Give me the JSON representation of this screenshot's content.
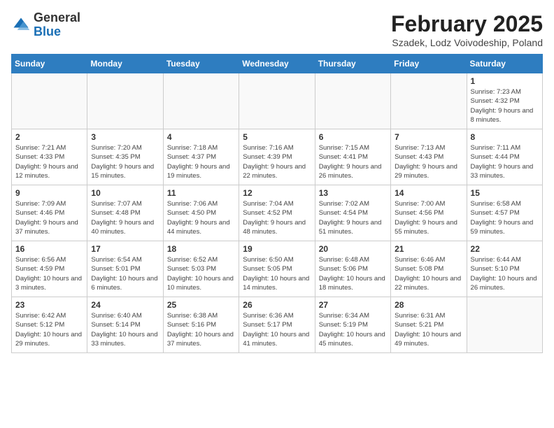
{
  "logo": {
    "general": "General",
    "blue": "Blue"
  },
  "header": {
    "title": "February 2025",
    "subtitle": "Szadek, Lodz Voivodeship, Poland"
  },
  "weekdays": [
    "Sunday",
    "Monday",
    "Tuesday",
    "Wednesday",
    "Thursday",
    "Friday",
    "Saturday"
  ],
  "weeks": [
    [
      {
        "day": "",
        "info": ""
      },
      {
        "day": "",
        "info": ""
      },
      {
        "day": "",
        "info": ""
      },
      {
        "day": "",
        "info": ""
      },
      {
        "day": "",
        "info": ""
      },
      {
        "day": "",
        "info": ""
      },
      {
        "day": "1",
        "info": "Sunrise: 7:23 AM\nSunset: 4:32 PM\nDaylight: 9 hours and 8 minutes."
      }
    ],
    [
      {
        "day": "2",
        "info": "Sunrise: 7:21 AM\nSunset: 4:33 PM\nDaylight: 9 hours and 12 minutes."
      },
      {
        "day": "3",
        "info": "Sunrise: 7:20 AM\nSunset: 4:35 PM\nDaylight: 9 hours and 15 minutes."
      },
      {
        "day": "4",
        "info": "Sunrise: 7:18 AM\nSunset: 4:37 PM\nDaylight: 9 hours and 19 minutes."
      },
      {
        "day": "5",
        "info": "Sunrise: 7:16 AM\nSunset: 4:39 PM\nDaylight: 9 hours and 22 minutes."
      },
      {
        "day": "6",
        "info": "Sunrise: 7:15 AM\nSunset: 4:41 PM\nDaylight: 9 hours and 26 minutes."
      },
      {
        "day": "7",
        "info": "Sunrise: 7:13 AM\nSunset: 4:43 PM\nDaylight: 9 hours and 29 minutes."
      },
      {
        "day": "8",
        "info": "Sunrise: 7:11 AM\nSunset: 4:44 PM\nDaylight: 9 hours and 33 minutes."
      }
    ],
    [
      {
        "day": "9",
        "info": "Sunrise: 7:09 AM\nSunset: 4:46 PM\nDaylight: 9 hours and 37 minutes."
      },
      {
        "day": "10",
        "info": "Sunrise: 7:07 AM\nSunset: 4:48 PM\nDaylight: 9 hours and 40 minutes."
      },
      {
        "day": "11",
        "info": "Sunrise: 7:06 AM\nSunset: 4:50 PM\nDaylight: 9 hours and 44 minutes."
      },
      {
        "day": "12",
        "info": "Sunrise: 7:04 AM\nSunset: 4:52 PM\nDaylight: 9 hours and 48 minutes."
      },
      {
        "day": "13",
        "info": "Sunrise: 7:02 AM\nSunset: 4:54 PM\nDaylight: 9 hours and 51 minutes."
      },
      {
        "day": "14",
        "info": "Sunrise: 7:00 AM\nSunset: 4:56 PM\nDaylight: 9 hours and 55 minutes."
      },
      {
        "day": "15",
        "info": "Sunrise: 6:58 AM\nSunset: 4:57 PM\nDaylight: 9 hours and 59 minutes."
      }
    ],
    [
      {
        "day": "16",
        "info": "Sunrise: 6:56 AM\nSunset: 4:59 PM\nDaylight: 10 hours and 3 minutes."
      },
      {
        "day": "17",
        "info": "Sunrise: 6:54 AM\nSunset: 5:01 PM\nDaylight: 10 hours and 6 minutes."
      },
      {
        "day": "18",
        "info": "Sunrise: 6:52 AM\nSunset: 5:03 PM\nDaylight: 10 hours and 10 minutes."
      },
      {
        "day": "19",
        "info": "Sunrise: 6:50 AM\nSunset: 5:05 PM\nDaylight: 10 hours and 14 minutes."
      },
      {
        "day": "20",
        "info": "Sunrise: 6:48 AM\nSunset: 5:06 PM\nDaylight: 10 hours and 18 minutes."
      },
      {
        "day": "21",
        "info": "Sunrise: 6:46 AM\nSunset: 5:08 PM\nDaylight: 10 hours and 22 minutes."
      },
      {
        "day": "22",
        "info": "Sunrise: 6:44 AM\nSunset: 5:10 PM\nDaylight: 10 hours and 26 minutes."
      }
    ],
    [
      {
        "day": "23",
        "info": "Sunrise: 6:42 AM\nSunset: 5:12 PM\nDaylight: 10 hours and 29 minutes."
      },
      {
        "day": "24",
        "info": "Sunrise: 6:40 AM\nSunset: 5:14 PM\nDaylight: 10 hours and 33 minutes."
      },
      {
        "day": "25",
        "info": "Sunrise: 6:38 AM\nSunset: 5:16 PM\nDaylight: 10 hours and 37 minutes."
      },
      {
        "day": "26",
        "info": "Sunrise: 6:36 AM\nSunset: 5:17 PM\nDaylight: 10 hours and 41 minutes."
      },
      {
        "day": "27",
        "info": "Sunrise: 6:34 AM\nSunset: 5:19 PM\nDaylight: 10 hours and 45 minutes."
      },
      {
        "day": "28",
        "info": "Sunrise: 6:31 AM\nSunset: 5:21 PM\nDaylight: 10 hours and 49 minutes."
      },
      {
        "day": "",
        "info": ""
      }
    ]
  ]
}
